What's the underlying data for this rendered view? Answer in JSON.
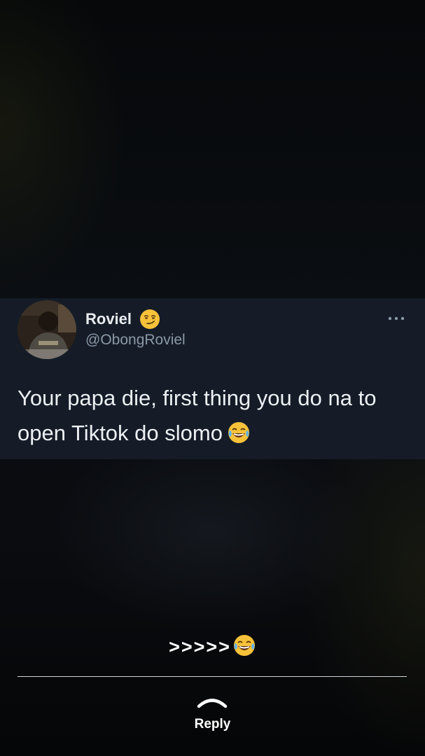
{
  "tweet": {
    "display_name": "Roviel",
    "name_emoji": "smirking-face",
    "handle": "@ObongRoviel",
    "text": "Your papa die, first thing you do na to open Tiktok do slomo",
    "text_emoji": "face-with-tears-of-joy",
    "card_color": "#151c28"
  },
  "caption": {
    "text": ">>>>>",
    "emoji": "face-with-tears-of-joy"
  },
  "reply": {
    "label": "Reply",
    "icon": "chevron-up"
  }
}
